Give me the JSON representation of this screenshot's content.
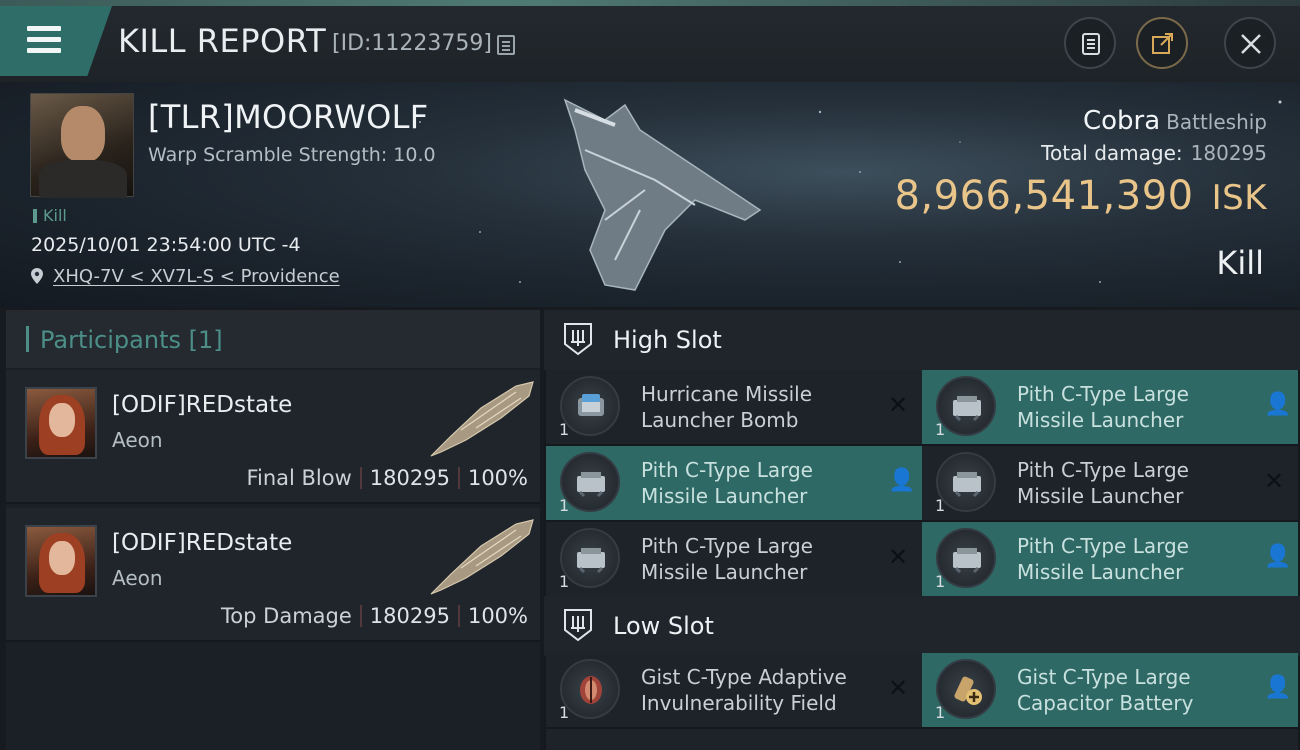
{
  "header": {
    "title": "KILL REPORT",
    "report_id": "[ID:11223759]"
  },
  "victim": {
    "name": "[TLR]MOORWOLF",
    "warp_scramble": "Warp Scramble Strength: 10.0",
    "kill_tag": "Kill",
    "datetime": "2025/10/01 23:54:00 UTC -4",
    "location": "XHQ-7V < XV7L-S < Providence",
    "ship_name": "Cobra",
    "ship_class": "Battleship",
    "total_damage_label": "Total damage:",
    "total_damage": "180295",
    "isk_value": "8,966,541,390",
    "isk_unit": "ISK",
    "result": "Kill"
  },
  "participants": {
    "title": "Participants [1]",
    "items": [
      {
        "name": "[ODIF]REDstate",
        "ship": "Aeon",
        "role": "Final Blow",
        "damage": "180295",
        "percent": "100%"
      },
      {
        "name": "[ODIF]REDstate",
        "ship": "Aeon",
        "role": "Top Damage",
        "damage": "180295",
        "percent": "100%"
      }
    ]
  },
  "high_slot": {
    "title": "High Slot",
    "modules": [
      {
        "line1": "Hurricane Missile",
        "line2": "Launcher Bomb",
        "qty": "1",
        "status": "destroyed",
        "status_glyph": "✕",
        "icon": "missile-bomb-icon"
      },
      {
        "line1": "Pith C-Type Large",
        "line2": "Missile Launcher",
        "qty": "1",
        "status": "dropped",
        "status_glyph": "👤",
        "icon": "missile-launcher-icon"
      },
      {
        "line1": "Pith C-Type Large",
        "line2": "Missile Launcher",
        "qty": "1",
        "status": "dropped",
        "status_glyph": "👤",
        "icon": "missile-launcher-icon"
      },
      {
        "line1": "Pith C-Type Large",
        "line2": "Missile Launcher",
        "qty": "1",
        "status": "destroyed",
        "status_glyph": "✕",
        "icon": "missile-launcher-icon"
      },
      {
        "line1": "Pith C-Type Large",
        "line2": "Missile Launcher",
        "qty": "1",
        "status": "destroyed",
        "status_glyph": "✕",
        "icon": "missile-launcher-icon"
      },
      {
        "line1": "Pith C-Type Large",
        "line2": "Missile Launcher",
        "qty": "1",
        "status": "dropped",
        "status_glyph": "👤",
        "icon": "missile-launcher-icon"
      }
    ]
  },
  "low_slot": {
    "title": "Low Slot",
    "modules": [
      {
        "line1": "Gist C-Type Adaptive",
        "line2": "Invulnerability Field",
        "qty": "1",
        "status": "destroyed",
        "status_glyph": "✕",
        "icon": "shield-hardener-icon"
      },
      {
        "line1": "Gist C-Type Large",
        "line2": "Capacitor Battery",
        "qty": "1",
        "status": "dropped",
        "status_glyph": "👤",
        "icon": "capacitor-battery-icon"
      }
    ]
  },
  "colors": {
    "accent": "#2e6965",
    "isk": "#e9c58a",
    "participant_title": "#4c8e88"
  }
}
